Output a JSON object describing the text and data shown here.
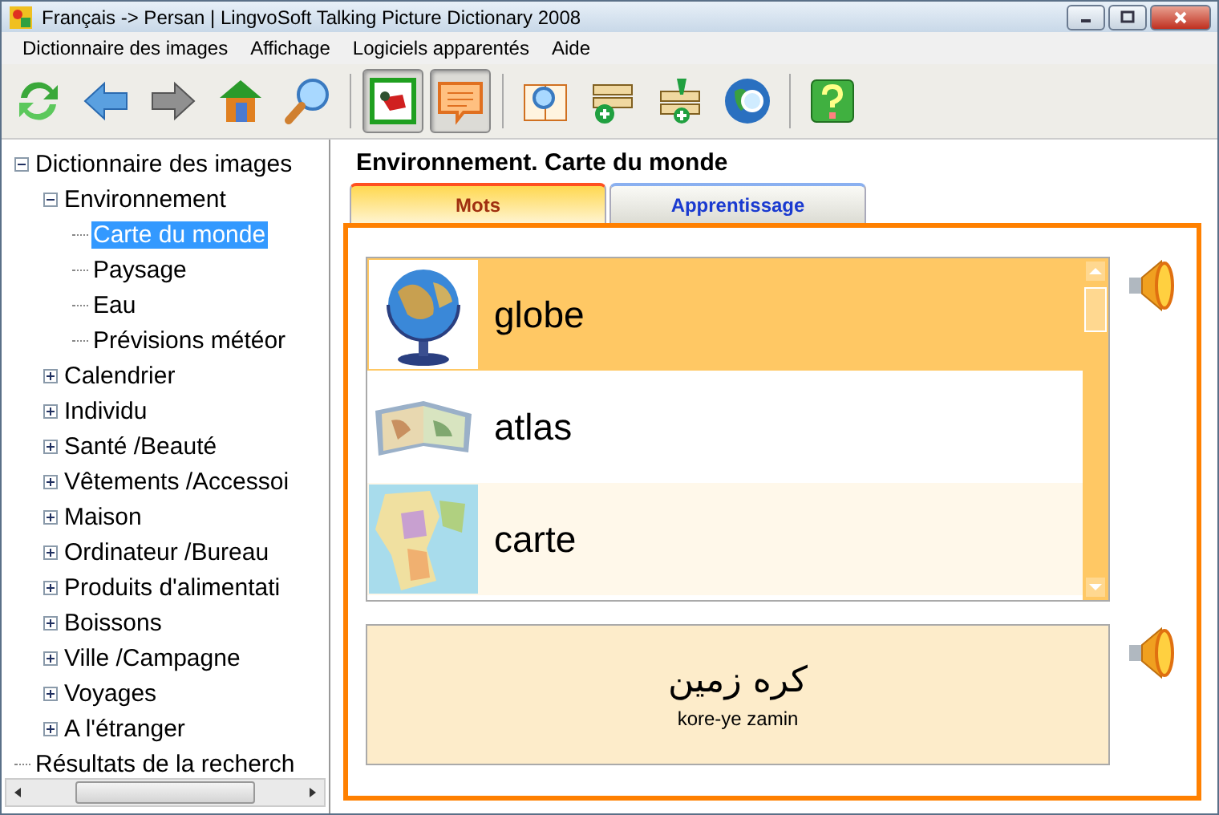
{
  "window": {
    "title": "Français -> Persan | LingvoSoft Talking Picture Dictionary 2008"
  },
  "menu": [
    "Dictionnaire des images",
    "Affichage",
    "Logiciels apparentés",
    "Aide"
  ],
  "toolbar": [
    {
      "pressed": false
    },
    {
      "pressed": false
    },
    {
      "pressed": false
    },
    {
      "pressed": false
    },
    {
      "pressed": false
    },
    {
      "pressed": true
    },
    {
      "pressed": true
    },
    {
      "pressed": false
    },
    {
      "pressed": false
    },
    {
      "pressed": false
    },
    {
      "pressed": false
    },
    {
      "pressed": false
    }
  ],
  "tree": [
    {
      "label": "Dictionnaire des images",
      "expanded": true,
      "selected": false,
      "children": [
        {
          "label": "Environnement",
          "expanded": true,
          "selected": false,
          "children": [
            {
              "label": "Carte du monde",
              "selected": true
            },
            {
              "label": "Paysage",
              "selected": false
            },
            {
              "label": "Eau",
              "selected": false
            },
            {
              "label": "Prévisions météor",
              "selected": false
            }
          ]
        },
        {
          "label": "Calendrier",
          "expanded": false,
          "selected": false
        },
        {
          "label": "Individu",
          "expanded": false,
          "selected": false
        },
        {
          "label": "Santé /Beauté",
          "expanded": false,
          "selected": false
        },
        {
          "label": "Vêtements /Accessoi",
          "expanded": false,
          "selected": false
        },
        {
          "label": "Maison",
          "expanded": false,
          "selected": false
        },
        {
          "label": "Ordinateur /Bureau",
          "expanded": false,
          "selected": false
        },
        {
          "label": "Produits d'alimentati",
          "expanded": false,
          "selected": false
        },
        {
          "label": "Boissons",
          "expanded": false,
          "selected": false
        },
        {
          "label": "Ville /Campagne",
          "expanded": false,
          "selected": false
        },
        {
          "label": "Voyages",
          "expanded": false,
          "selected": false
        },
        {
          "label": "A l'étranger",
          "expanded": false,
          "selected": false
        }
      ]
    },
    {
      "label": "Résultats de la recherch",
      "selected": false
    }
  ],
  "heading": "Environnement. Carte du monde",
  "tabs": [
    {
      "label": "Mots",
      "selected": true
    },
    {
      "label": "Apprentissage",
      "selected": false
    }
  ],
  "words": [
    {
      "word": "globe",
      "selected": true,
      "kind": "picture"
    },
    {
      "word": "atlas",
      "selected": false,
      "kind": "picture"
    },
    {
      "word": "carte",
      "selected": false,
      "kind": "picture"
    }
  ],
  "translation": {
    "text": "کره زمین",
    "transliteration": "kore-ye zamin"
  }
}
